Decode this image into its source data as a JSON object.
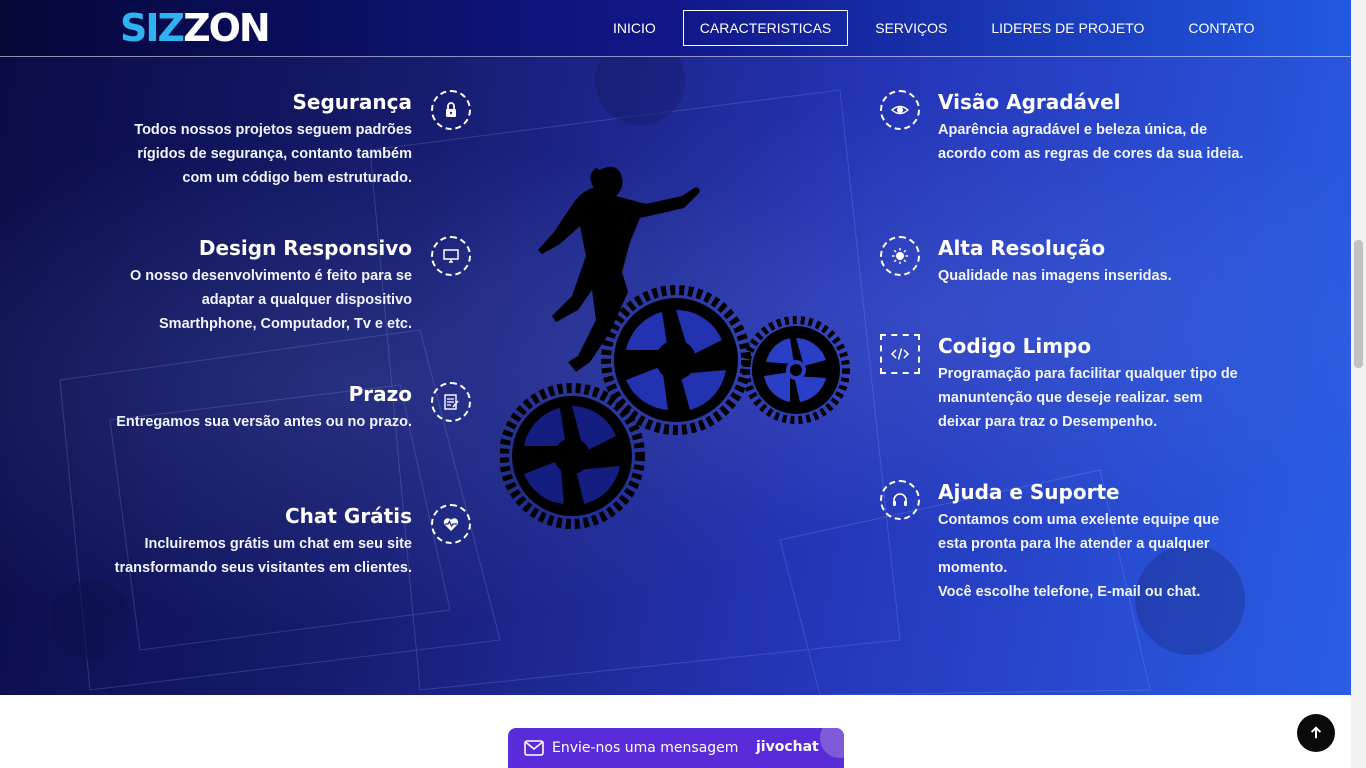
{
  "header": {
    "logo": {
      "part_a": "SIZ",
      "part_b": "ZON"
    },
    "nav": [
      {
        "label": "INICIO"
      },
      {
        "label": "CARACTERISTICAS",
        "active": true
      },
      {
        "label": "SERVIÇOS"
      },
      {
        "label": "LIDERES DE PROJETO"
      },
      {
        "label": "CONTATO"
      }
    ]
  },
  "features_left": [
    {
      "title": "Segurança",
      "description": "Todos nossos projetos seguem padrões rígidos de segurança, contanto também com um código bem estruturado.",
      "icon": "lock-icon"
    },
    {
      "title": "Design Responsivo",
      "description": "O nosso desenvolvimento é feito para se adaptar a qualquer dispositivo Smarthphone, Computador, Tv e etc.",
      "icon": "monitor-icon"
    },
    {
      "title": "Prazo",
      "description": "Entregamos sua versão antes ou no prazo.",
      "icon": "document-edit-icon"
    },
    {
      "title": "Chat Grátis",
      "description": "Incluiremos grátis um chat em seu site transformando seus visitantes em clientes.",
      "icon": "heart-pulse-icon"
    }
  ],
  "features_right": [
    {
      "title": "Visão Agradável",
      "description": "Aparência agradável e beleza única, de acordo com as regras de cores da sua ideia.",
      "icon": "eye-icon"
    },
    {
      "title": "Alta Resolução",
      "description": "Qualidade nas imagens inseridas.",
      "icon": "sun-icon"
    },
    {
      "title": "Codigo Limpo",
      "description": "Programação para facilitar qualquer tipo de manuntenção que deseje realizar. sem deixar para traz o Desempenho.",
      "icon": "code-icon"
    },
    {
      "title": "Ajuda e Suporte",
      "description": "Contamos com uma exelente equipe que esta pronta para lhe atender a qualquer momento.",
      "description2": "Você escolhe telefone, E-mail ou chat.",
      "icon": "headset-icon"
    }
  ],
  "chat_widget": {
    "label": "Envie-nos uma mensagem",
    "brand": "jivochat"
  },
  "colors": {
    "accent": "#2fb2f0",
    "chat": "#5a2bd9",
    "hero_start": "#0a0b45",
    "hero_end": "#2a5ee6"
  }
}
